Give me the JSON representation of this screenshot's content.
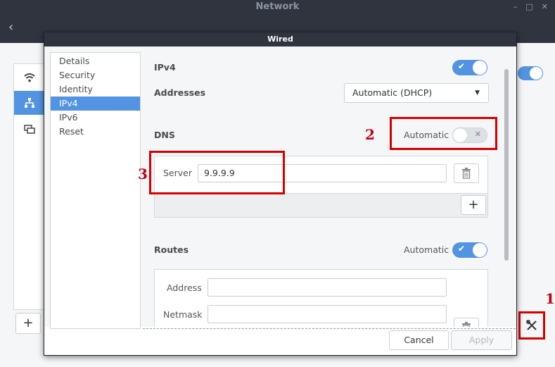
{
  "window": {
    "title": "Network",
    "controls": [
      "–",
      "□",
      "✕"
    ]
  },
  "dialog": {
    "title": "Wired",
    "nav": [
      "Details",
      "Security",
      "Identity",
      "IPv4",
      "IPv6",
      "Reset"
    ],
    "selected_nav": "IPv4",
    "ipv4": {
      "label": "IPv4",
      "enabled": true
    },
    "addresses": {
      "label": "Addresses",
      "method": "Automatic (DHCP)"
    },
    "dns": {
      "label": "DNS",
      "automatic_label": "Automatic",
      "automatic": false,
      "server_label": "Server",
      "server_value": "9.9.9.9"
    },
    "routes": {
      "label": "Routes",
      "automatic_label": "Automatic",
      "automatic": true,
      "address_label": "Address",
      "netmask_label": "Netmask"
    },
    "buttons": {
      "cancel": "Cancel",
      "apply": "Apply"
    }
  },
  "annotations": [
    "1",
    "2",
    "3"
  ],
  "colors": {
    "accent": "#5294e2",
    "titlebar": "#2f343f",
    "highlight": "#d40000"
  }
}
